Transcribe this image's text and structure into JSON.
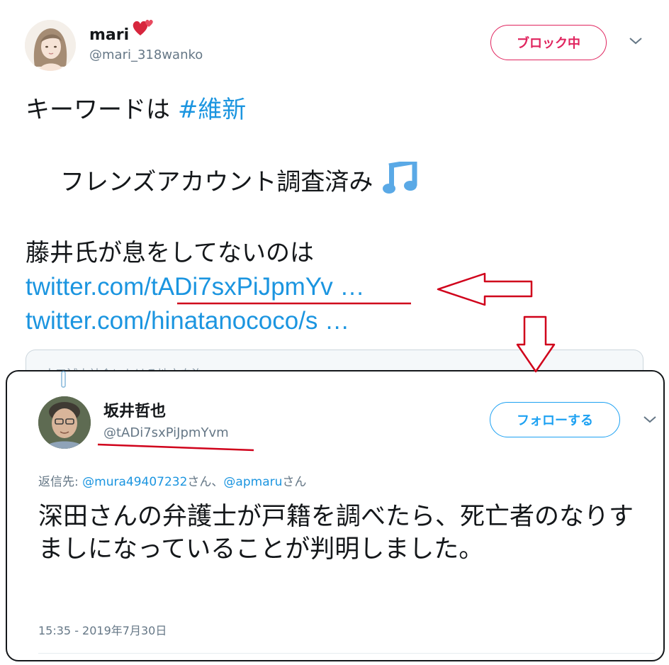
{
  "top_tweet": {
    "display_name": "mari",
    "handle": "@mari_318wanko",
    "block_button": "ブロック中",
    "line1_text": "キーワードは ",
    "line1_hashtag": "#維新",
    "line2_text": "フレンズアカウント調査済み",
    "line3_text": "藤井氏が息をしてないのは",
    "link1": "twitter.com/tADi7sxPiJpmYv …",
    "link2": "twitter.com/hinatanococo/s …",
    "quote_faint_text": "人口減少社会における地方自治",
    "emoji_icon": "music-notes-icon"
  },
  "quoted_tweet": {
    "display_name": "坂井哲也",
    "handle": "@tADi7sxPiJpmYvm",
    "follow_button": "フォローする",
    "reply_prefix": "返信先: ",
    "reply_mention1": "@mura49407232",
    "reply_sep": "さん、",
    "reply_mention2": "@apmaru",
    "reply_suffix": "さん",
    "body": "深田さんの弁護士が戸籍を調べたら、死亡者のなりすましになっていることが判明しました。",
    "timestamp": "15:35 - 2019年7月30日"
  },
  "colors": {
    "link": "#1b95e0",
    "block": "#e0245e",
    "follow": "#1da1f2",
    "annotation_red": "#d0021b",
    "muted": "#657786"
  }
}
